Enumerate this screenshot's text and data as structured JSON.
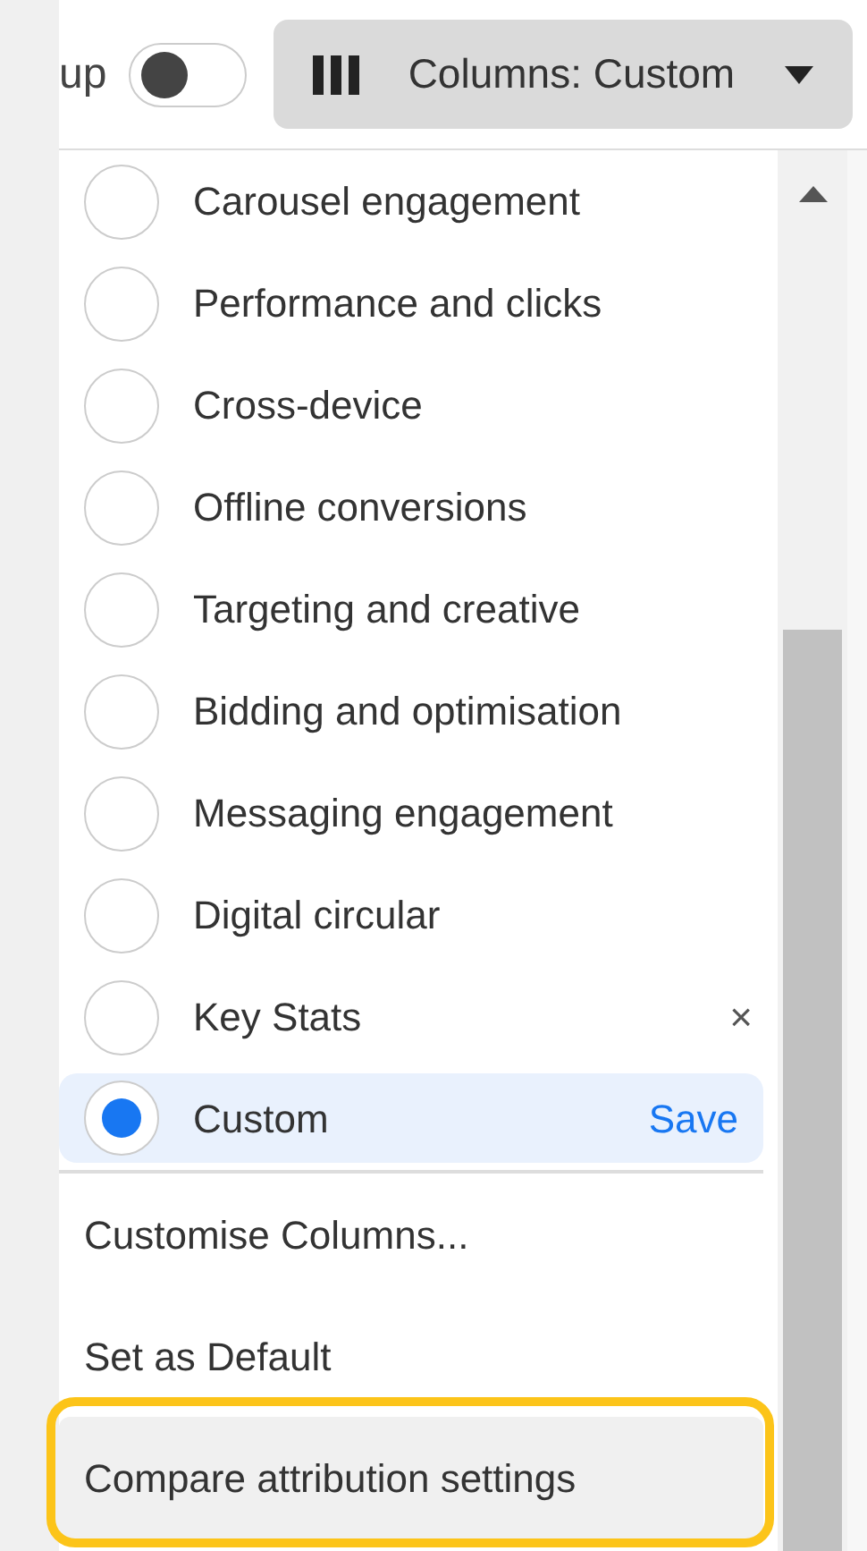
{
  "toolbar": {
    "toggle_label": "up",
    "toggle_on": false,
    "columns_button": {
      "label": "Columns: Custom"
    }
  },
  "presets": [
    {
      "label": "Carousel engagement",
      "selected": false
    },
    {
      "label": "Performance and clicks",
      "selected": false
    },
    {
      "label": "Cross-device",
      "selected": false
    },
    {
      "label": "Offline conversions",
      "selected": false
    },
    {
      "label": "Targeting and creative",
      "selected": false
    },
    {
      "label": "Bidding and optimisation",
      "selected": false
    },
    {
      "label": "Messaging engagement",
      "selected": false
    },
    {
      "label": "Digital circular",
      "selected": false
    },
    {
      "label": "Key Stats",
      "selected": false,
      "action": "×"
    },
    {
      "label": "Custom",
      "selected": true,
      "action": "Save"
    }
  ],
  "actions": [
    {
      "label": "Customise Columns..."
    },
    {
      "label": "Set as Default"
    },
    {
      "label": "Compare attribution settings",
      "highlighted": true
    }
  ]
}
